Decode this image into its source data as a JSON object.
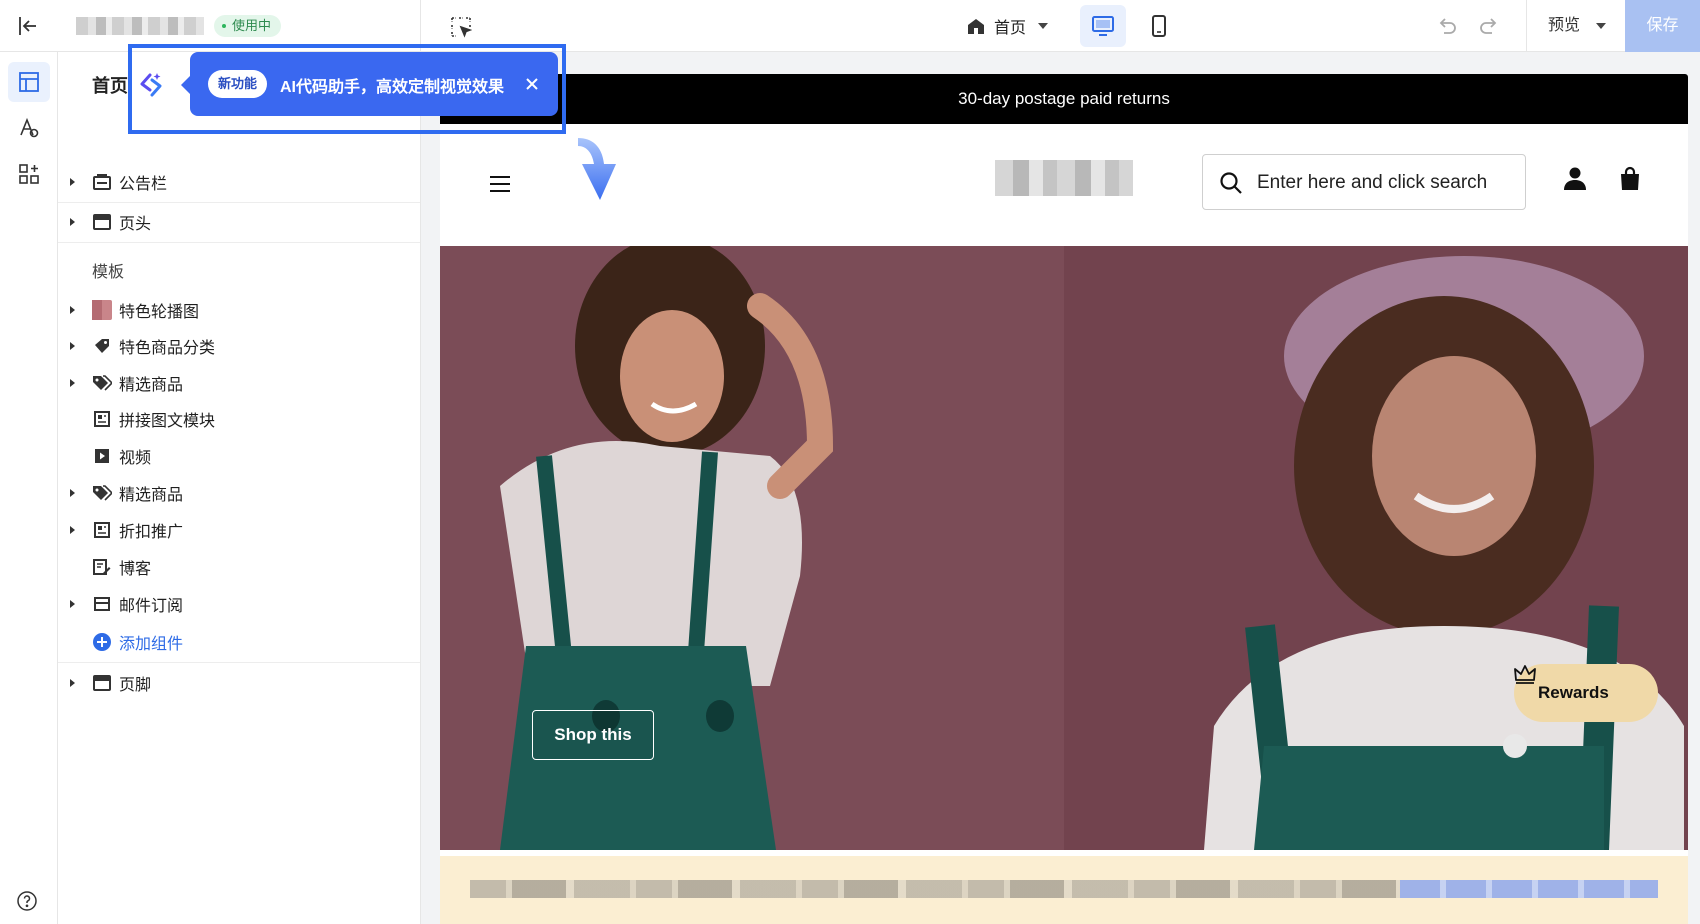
{
  "topbar": {
    "store_status": "使用中",
    "page_selector": "首页",
    "preview_label": "预览",
    "save_label": "保存"
  },
  "sidebar": {
    "title": "首页",
    "header_groups": [
      {
        "label": "公告栏",
        "icon": "announcement-icon",
        "expandable": true
      },
      {
        "label": "页头",
        "icon": "header-layout-icon",
        "expandable": true
      }
    ],
    "template_section": "模板",
    "template_items": [
      {
        "label": "特色轮播图",
        "icon": "slideshow-thumbnail",
        "expandable": true
      },
      {
        "label": "特色商品分类",
        "icon": "collection-tag-icon",
        "expandable": true
      },
      {
        "label": "精选商品",
        "icon": "product-tags-icon",
        "expandable": true
      },
      {
        "label": "拼接图文模块",
        "icon": "image-text-icon",
        "expandable": false
      },
      {
        "label": "视频",
        "icon": "video-play-icon",
        "expandable": false
      },
      {
        "label": "精选商品",
        "icon": "product-tags-icon",
        "expandable": true
      },
      {
        "label": "折扣推广",
        "icon": "promotion-icon",
        "expandable": true
      },
      {
        "label": "博客",
        "icon": "blog-edit-icon",
        "expandable": false
      },
      {
        "label": "邮件订阅",
        "icon": "email-icon",
        "expandable": true
      }
    ],
    "add_component": "添加组件",
    "footer_group": {
      "label": "页脚",
      "icon": "footer-layout-icon",
      "expandable": true
    }
  },
  "tooltip": {
    "badge": "新功能",
    "text": "AI代码助手，高效定制视觉效果"
  },
  "store": {
    "announcement": "30-day postage paid returns",
    "search_placeholder": "Enter here and click search",
    "hero_button": "Shop this",
    "rewards_label": "Rewards"
  },
  "colors": {
    "accent": "#3a68f0",
    "save_disabled": "#a9c1f2",
    "live_badge": "#2d8a4e",
    "rewards_bg": "#f0d9a8",
    "hero_bg": "#7a4a55"
  }
}
